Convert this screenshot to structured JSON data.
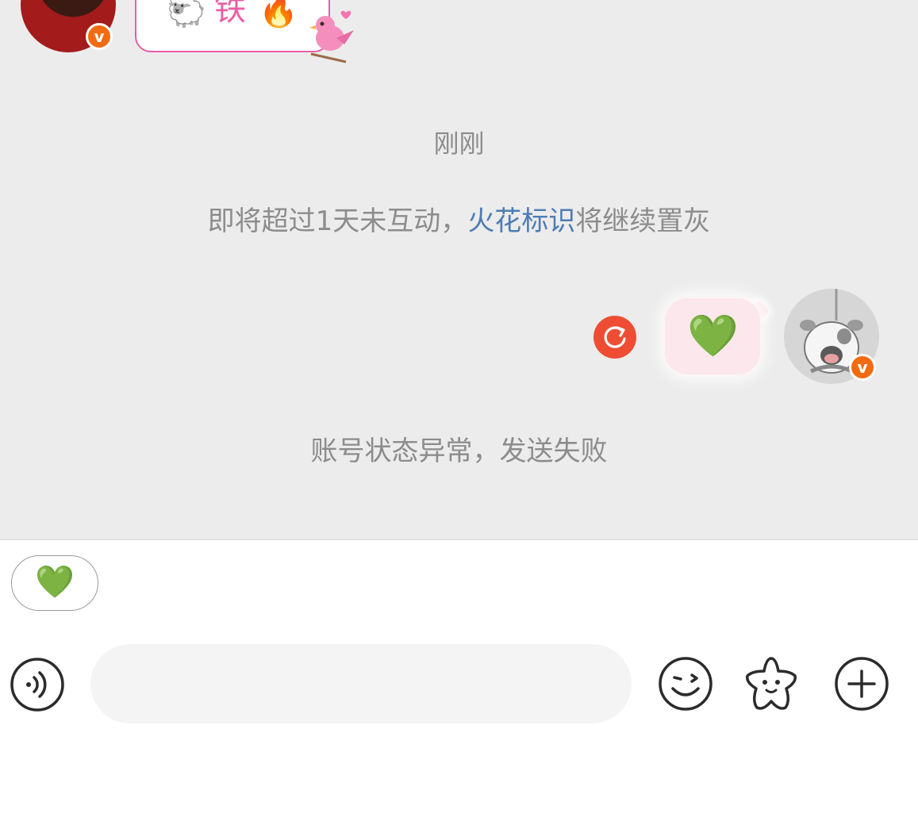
{
  "chat": {
    "peer_bubble": {
      "tag_char": "铁",
      "glyph_sheep": "🐑",
      "glyph_fire": "🔥"
    },
    "timestamp": "刚刚",
    "notice": {
      "prefix": "即将超过1天未互动，",
      "link": "火花标识",
      "suffix": "将继续置灰"
    },
    "sent_message": {
      "text": "💚"
    },
    "send_error": "账号状态异常，发送失败",
    "badge_letter": "v"
  },
  "quick_reply": {
    "text": "💚"
  },
  "input": {
    "placeholder": "",
    "value": ""
  },
  "colors": {
    "accent_pink": "#ea5fa4",
    "link_blue": "#4e7cb2",
    "retry_red": "#ee4d34",
    "badge_orange": "#f26b12",
    "chat_bg": "#ececec"
  },
  "icons": {
    "voice": "voice-icon",
    "emoji": "emoji-icon",
    "sticker": "sticker-star-icon",
    "plus": "plus-icon",
    "retry": "retry-icon"
  }
}
